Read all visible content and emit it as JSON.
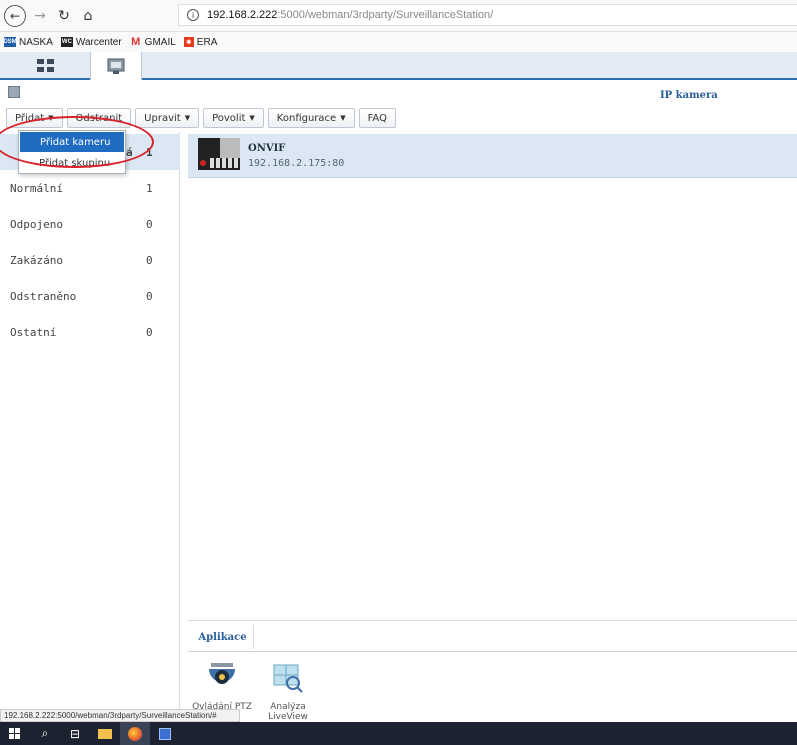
{
  "browser": {
    "url_host": "192.168.2.222",
    "url_path": ":5000/webman/3rdparty/SurveillanceStation/",
    "bookmarks": [
      {
        "label": "NASKA",
        "icon": "dsm-icon"
      },
      {
        "label": "Warcenter",
        "icon": "wc-icon"
      },
      {
        "label": "GMAIL",
        "icon": "gmail-icon"
      },
      {
        "label": "ERA",
        "icon": "era-icon"
      }
    ],
    "status_url": "192.168.2.222:5000/webman/3rdparty/SurveillanceStation/#"
  },
  "app": {
    "title": "IP kamera"
  },
  "toolbar": {
    "add": "Přidat",
    "remove": "Odstranit",
    "edit": "Upravit",
    "enable": "Povolit",
    "config": "Konfigurace",
    "faq": "FAQ"
  },
  "dropdown": {
    "add_camera": "Přidat kameru",
    "add_group": "Přidat skupinu"
  },
  "leftnav": {
    "items": [
      {
        "label": "",
        "count": "1"
      },
      {
        "label": "Normální",
        "count": "1"
      },
      {
        "label": "Odpojeno",
        "count": "0"
      },
      {
        "label": "Zakázáno",
        "count": "0"
      },
      {
        "label": "Odstraněno",
        "count": "0"
      },
      {
        "label": "Ostatní",
        "count": "0"
      }
    ],
    "partial_visible_char": "á"
  },
  "cameras": [
    {
      "name": "ONVIF",
      "address": "192.168.2.175:80"
    }
  ],
  "apps": {
    "tab_label": "Aplikace",
    "items": [
      {
        "label": "Ovládání PTZ"
      },
      {
        "label": "Analýza LiveView"
      }
    ]
  },
  "colors": {
    "accent": "#1f6cc1",
    "title_blue": "#2a5d9a",
    "selected_row": "#dbe8f4",
    "annotation_red": "#d9232b"
  }
}
